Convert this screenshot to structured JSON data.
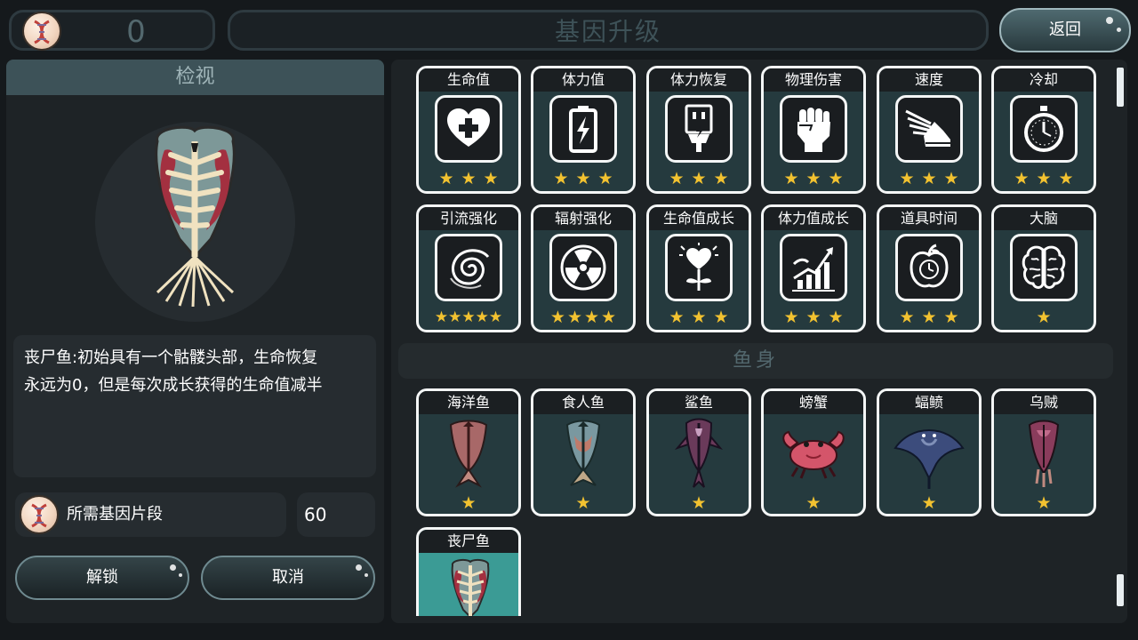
{
  "header": {
    "currency_value": "0",
    "title": "基因升级",
    "back_label": "返回"
  },
  "inspect": {
    "title": "检视",
    "description_line1": "丧尸鱼:初始具有一个骷髅头部，生命恢复",
    "description_line2": "永远为0，但是每次成长获得的生命值减半",
    "cost_label": "所需基因片段",
    "cost_value": "60",
    "unlock_label": "解锁",
    "cancel_label": "取消"
  },
  "attributes": [
    {
      "name": "生命值",
      "icon": "heart-plus-icon",
      "stars": "★★★",
      "star_count": 3
    },
    {
      "name": "体力值",
      "icon": "battery-icon",
      "stars": "★★★",
      "star_count": 3
    },
    {
      "name": "体力恢复",
      "icon": "charging-plug-icon",
      "stars": "★★★",
      "star_count": 3
    },
    {
      "name": "物理伤害",
      "icon": "fist-icon",
      "stars": "★★★",
      "star_count": 3
    },
    {
      "name": "速度",
      "icon": "winged-shoe-icon",
      "stars": "★★★",
      "star_count": 3
    },
    {
      "name": "冷却",
      "icon": "stopwatch-icon",
      "stars": "★★★",
      "star_count": 3
    },
    {
      "name": "引流强化",
      "icon": "vortex-icon",
      "stars": "★★★★★",
      "star_count": 5
    },
    {
      "name": "辐射强化",
      "icon": "radiation-icon",
      "stars": "★★★★",
      "star_count": 4
    },
    {
      "name": "生命值成长",
      "icon": "heart-flower-icon",
      "stars": "★★★",
      "star_count": 3
    },
    {
      "name": "体力值成长",
      "icon": "growth-chart-icon",
      "stars": "★★★",
      "star_count": 3
    },
    {
      "name": "道具时间",
      "icon": "apple-clock-icon",
      "stars": "★★★",
      "star_count": 3
    },
    {
      "name": "大脑",
      "icon": "brain-icon",
      "stars": "★",
      "star_count": 1
    }
  ],
  "fish_section": {
    "title": "鱼身",
    "items": [
      {
        "name": "海洋鱼",
        "icon": "ocean-fish-icon",
        "stars": "★",
        "color": "#a05a5a"
      },
      {
        "name": "食人鱼",
        "icon": "piranha-icon",
        "stars": "★",
        "color": "#6a8a90"
      },
      {
        "name": "鲨鱼",
        "icon": "shark-icon",
        "stars": "★",
        "color": "#6a3a5a"
      },
      {
        "name": "螃蟹",
        "icon": "crab-icon",
        "stars": "★",
        "color": "#d05560"
      },
      {
        "name": "蝠鲼",
        "icon": "manta-ray-icon",
        "stars": "★",
        "color": "#3a4a7a"
      },
      {
        "name": "乌贼",
        "icon": "squid-icon",
        "stars": "★",
        "color": "#8a3a5a"
      },
      {
        "name": "丧尸鱼",
        "icon": "zombie-fish-icon",
        "stars": "",
        "color": "#3b9b95"
      }
    ]
  }
}
